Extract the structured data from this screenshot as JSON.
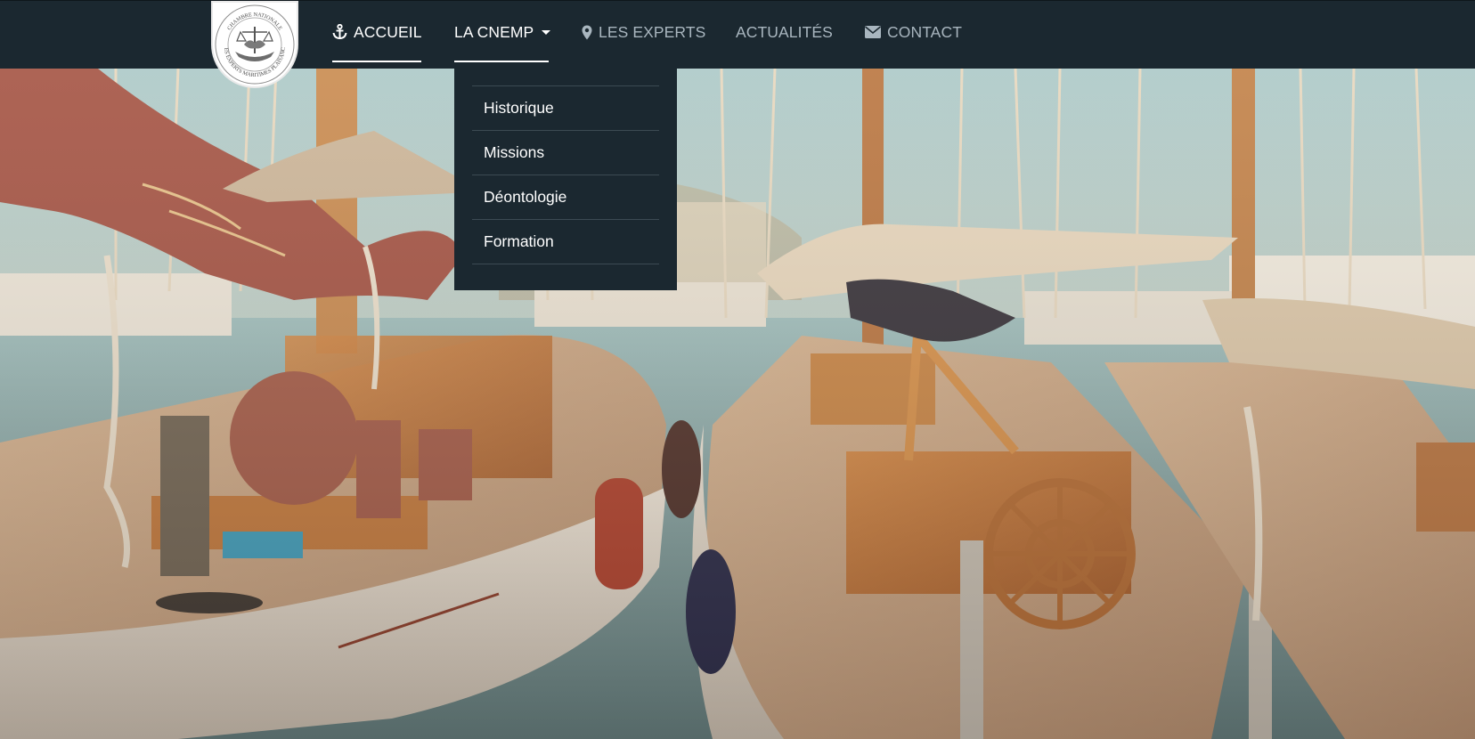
{
  "logo": {
    "text_top": "CHAMBRE NATIONALE",
    "text_bottom": "DES EXPERTS MARITIMES PLAISANCE"
  },
  "nav": {
    "items": [
      {
        "label": "ACCUEIL",
        "icon": "anchor-icon",
        "active": true
      },
      {
        "label": "LA CNEMP",
        "icon": "",
        "active": true,
        "dropdown": true
      },
      {
        "label": "LES EXPERTS",
        "icon": "map-marker-icon",
        "active": false
      },
      {
        "label": "ACTUALITÉS",
        "icon": "",
        "active": false
      },
      {
        "label": "CONTACT",
        "icon": "envelope-icon",
        "active": false
      }
    ]
  },
  "dropdown": {
    "items": [
      "Historique",
      "Missions",
      "Déontologie",
      "Formation"
    ]
  },
  "colors": {
    "navbar": "#1b2830",
    "nav_text": "#a9b6bf",
    "nav_active": "#ffffff"
  },
  "hero": {
    "image": "vintage-sailboats-marina-photo"
  }
}
